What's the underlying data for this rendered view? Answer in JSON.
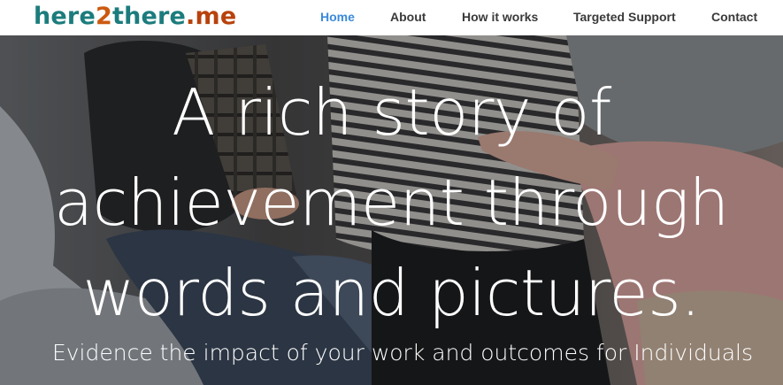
{
  "brand": {
    "part1": "here",
    "part2": "2",
    "part3": "there",
    "part4": ".me",
    "colors": {
      "teal": "#1c7c7d",
      "orange": "#cc5a10"
    }
  },
  "nav": {
    "items": [
      {
        "label": "Home",
        "active": true
      },
      {
        "label": "About",
        "active": false
      },
      {
        "label": "How it works",
        "active": false
      },
      {
        "label": "Targeted Support",
        "active": false
      },
      {
        "label": "Contact",
        "active": false
      }
    ],
    "active_color": "#3b8ad9"
  },
  "hero": {
    "title_lines": [
      "A rich story of",
      "achievement through",
      "words and pictures."
    ],
    "subtitle": "Evidence the impact of your work and outcomes for Individuals",
    "background": "photo-of-group-sitting-in-circle"
  }
}
